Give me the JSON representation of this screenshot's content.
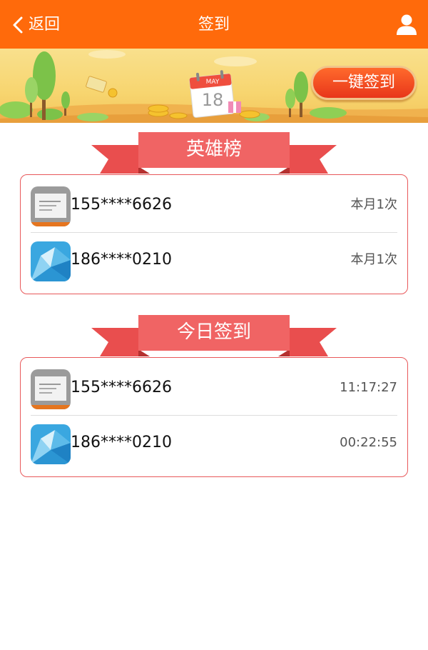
{
  "header": {
    "back_label": "返回",
    "title": "签到",
    "background": "#ff6a0b"
  },
  "banner": {
    "calendar_month": "MAY",
    "calendar_day": "18",
    "signin_button": "一键签到"
  },
  "hero_section": {
    "title": "英雄榜",
    "rows": [
      {
        "phone": "155****6626",
        "meta": "本月1次",
        "avatar": "screenshot-thumbnail"
      },
      {
        "phone": "186****0210",
        "meta": "本月1次",
        "avatar": "blue-crystal"
      }
    ]
  },
  "today_section": {
    "title": "今日签到",
    "rows": [
      {
        "phone": "155****6626",
        "meta": "11:17:27",
        "avatar": "screenshot-thumbnail"
      },
      {
        "phone": "186****0210",
        "meta": "00:22:55",
        "avatar": "blue-crystal"
      }
    ]
  },
  "colors": {
    "accent": "#ff6a0b",
    "ribbon": "#ee5b5b",
    "card_border": "#e8585a"
  }
}
